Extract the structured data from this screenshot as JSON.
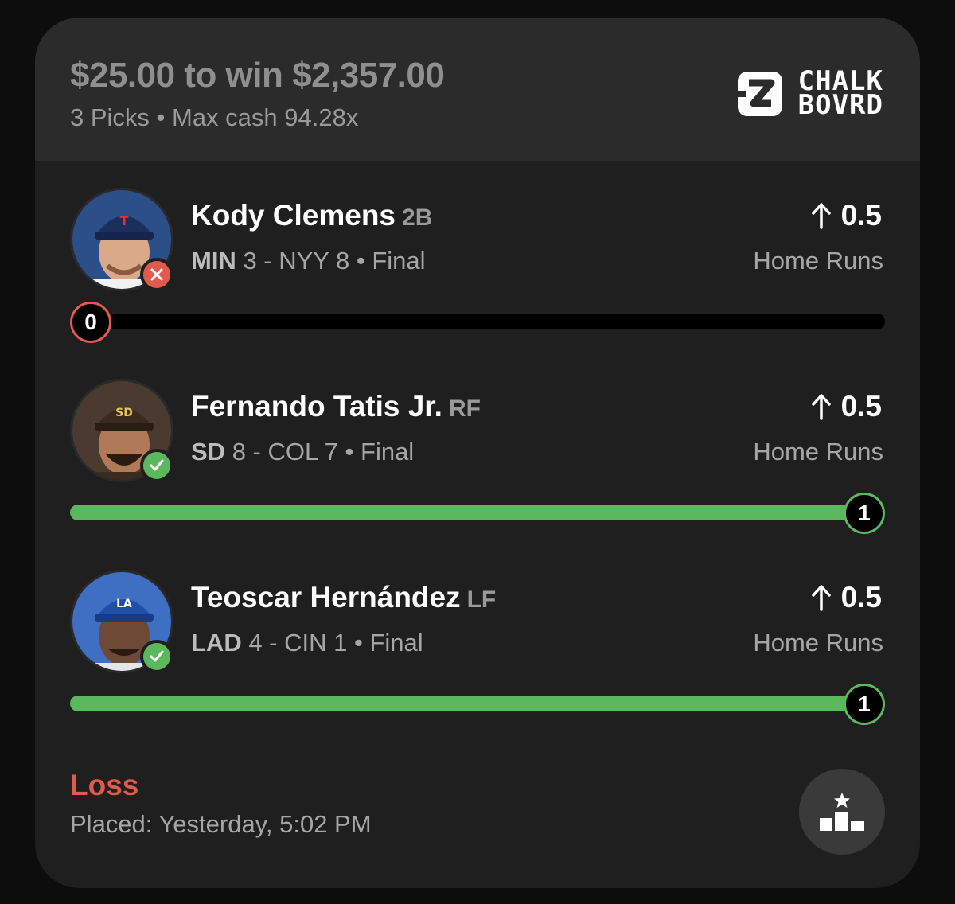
{
  "header": {
    "wager": "$25.00 to win $2,357.00",
    "subline": "3 Picks • Max cash 94.28x",
    "logo_line1": "CHALK",
    "logo_line2": "BOVRD"
  },
  "picks": [
    {
      "name": "Kody Clemens",
      "position": "2B",
      "team": "MIN",
      "score_text": " 3 - NYY 8 • Final",
      "line": "0.5",
      "stat": "Home Runs",
      "result": "miss",
      "actual": "0",
      "progress": 0,
      "cap_color": "#1c2f5a",
      "cap_logo": "T"
    },
    {
      "name": "Fernando Tatis Jr.",
      "position": "RF",
      "team": "SD",
      "score_text": " 8 - COL 7 • Final",
      "line": "0.5",
      "stat": "Home Runs",
      "result": "hit",
      "actual": "1",
      "progress": 1,
      "cap_color": "#3b2a1e",
      "cap_logo": "SD"
    },
    {
      "name": "Teoscar Hernández",
      "position": "LF",
      "team": "LAD",
      "score_text": " 4 - CIN 1 • Final",
      "line": "0.5",
      "stat": "Home Runs",
      "result": "hit",
      "actual": "1",
      "progress": 1,
      "cap_color": "#1f4fa8",
      "cap_logo": "LA"
    }
  ],
  "footer": {
    "status": "Loss",
    "placed": "Placed: Yesterday, 5:02 PM"
  },
  "colors": {
    "hit": "#5cb85c",
    "miss": "#e05a4e",
    "card": "#1f1f1f",
    "header": "#2b2b2b"
  },
  "icons": {
    "logo": "chalkboard-logo-icon",
    "arrow": "arrow-up-icon",
    "hit": "check-icon",
    "miss": "x-icon",
    "leaderboard": "podium-star-icon"
  }
}
